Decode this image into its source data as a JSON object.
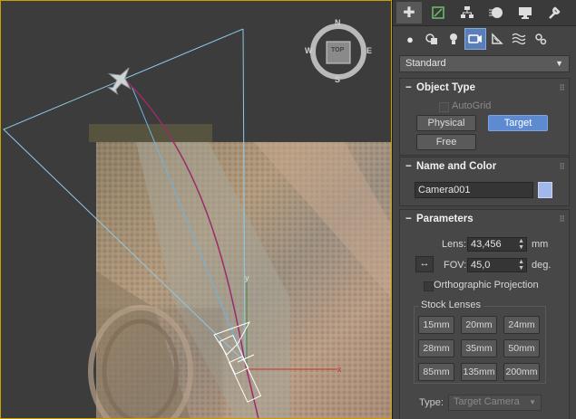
{
  "viewport": {
    "viewcube": {
      "top_face": "TOP",
      "n": "N",
      "s": "S",
      "e": "E",
      "w": "W"
    },
    "axis_labels": {
      "x": "x",
      "y": "y"
    }
  },
  "command_panel": {
    "tabs": [
      "create-icon",
      "modify-icon",
      "hierarchy-icon",
      "motion-icon",
      "display-icon",
      "utilities-icon"
    ],
    "categories": [
      "geometry-icon",
      "shapes-icon",
      "lights-icon",
      "cameras-icon",
      "helpers-icon",
      "spacewarps-icon",
      "systems-icon"
    ],
    "dropdown": "Standard",
    "object_type": {
      "title": "Object Type",
      "autogrid": "AutoGrid",
      "physical": "Physical",
      "target": "Target",
      "free": "Free"
    },
    "name_color": {
      "title": "Name and Color",
      "name": "Camera001",
      "color": "#a0b8ec"
    },
    "parameters": {
      "title": "Parameters",
      "lens_label": "Lens:",
      "lens_value": "43,456",
      "lens_unit": "mm",
      "fov_label": "FOV:",
      "fov_value": "45,0",
      "fov_unit": "deg.",
      "ortho": "Orthographic Projection",
      "stock_title": "Stock Lenses",
      "lenses": [
        "15mm",
        "20mm",
        "24mm",
        "28mm",
        "35mm",
        "50mm",
        "85mm",
        "135mm",
        "200mm"
      ],
      "type_label": "Type:",
      "type_value": "Target Camera"
    }
  }
}
